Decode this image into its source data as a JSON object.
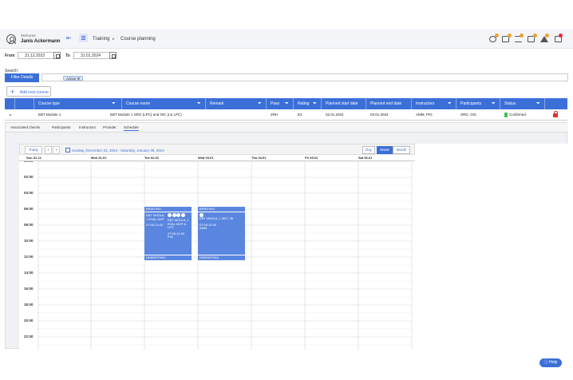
{
  "header": {
    "welcome": "Welcome",
    "username": "Janis Ackermann",
    "breadcrumb": [
      "Training",
      "Course planning"
    ],
    "colors": {
      "accent": "#3b6fd8",
      "badge_orange": "#f0a030",
      "badge_red": "#e03030"
    }
  },
  "dates": {
    "from_label": "From",
    "from_value": "31.12.2023",
    "to_label": "To",
    "to_value": "31.01.2024"
  },
  "search": {
    "label": "Search:",
    "filter_button": "Filter Details",
    "chip": "Active"
  },
  "add_button": "Add new course",
  "table": {
    "headers": [
      "Course type",
      "Course name",
      "Remark",
      "Pass",
      "Rating",
      "Planned start date",
      "Planned end date",
      "Instructors",
      "Participants",
      "Status"
    ],
    "row": {
      "course_type": "EBT Module 1",
      "course_name": "EBT Module 1 SRG (LPC) and OIC (no LPC)",
      "remark": "",
      "pass": "ZRH",
      "rating": "E2",
      "start": "02.01.2024",
      "end": "03.01.2024",
      "instructors": "AMM, PIG",
      "participants": "SRG, OIC",
      "status": "Confirmed"
    }
  },
  "tabs": [
    "Associated checks",
    "Participants",
    "Instructors",
    "Provider",
    "Schedule"
  ],
  "schedule": {
    "today": "Today",
    "prev": "‹",
    "next": "›",
    "range": "Sunday, December 31, 2023 - Saturday, January 06, 2024",
    "views": [
      "Day",
      "Week",
      "Month"
    ],
    "days": [
      "Sun 31.12",
      "Mon 01.01",
      "Tue 02.01",
      "Wed 03.01",
      "Thu 04.01",
      "Fri 05.01",
      "Sat 06.01"
    ],
    "times": [
      "00:00",
      "02:00",
      "04:00",
      "06:00",
      "08:00",
      "10:00",
      "12:00",
      "14:00",
      "16:00",
      "18:00",
      "20:00",
      "22:00"
    ],
    "events": {
      "tue_brief": "BRIEFING",
      "tue_a_title": "EBT MODUL 1 EVAL MVP",
      "tue_a_time": "07:00-11:00",
      "tue_b_title": "EBT MODUL 1 EVAL MVP & LPC",
      "tue_b_time": "07:00-11:00",
      "tue_b_code": "PIG",
      "tue_debrief": "DEBRIEFING",
      "wed_brief": "BRIEFING",
      "wed_title": "EBT MODUL 1 SBT / BI",
      "wed_time": "07:00-11:00",
      "wed_code": "AMM",
      "wed_debrief": "DEBRIEFING"
    }
  },
  "help": "Help"
}
